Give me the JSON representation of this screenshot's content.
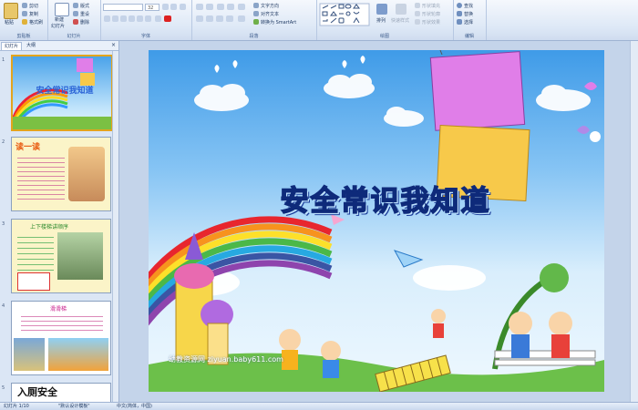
{
  "ribbon": {
    "clipboard": {
      "label": "剪贴板",
      "paste": "粘贴",
      "cut": "剪切",
      "copy": "复制",
      "format_painter": "格式刷"
    },
    "slides": {
      "label": "幻灯片",
      "new_slide": "新建",
      "new_slide2": "幻灯片",
      "layout": "版式",
      "reset": "重设",
      "delete": "删除"
    },
    "font": {
      "label": "字体",
      "font_name": "",
      "font_size": "32"
    },
    "paragraph": {
      "label": "段落",
      "text_direction": "文字方向",
      "align_text": "对齐文本",
      "smartart": "转换为 SmartArt"
    },
    "drawing": {
      "label": "绘图",
      "arrange": "排列",
      "quick_styles": "快速样式",
      "shape_fill": "形状填充",
      "shape_outline": "形状轮廓",
      "shape_effects": "形状效果"
    },
    "editing": {
      "label": "编辑",
      "find": "查找",
      "replace": "替换",
      "select": "选择"
    }
  },
  "panel": {
    "tab_slides": "幻灯片",
    "tab_outline": "大纲"
  },
  "thumbs": [
    {
      "num": "1",
      "title": "安全常识我知道"
    },
    {
      "num": "2",
      "title": "读一读"
    },
    {
      "num": "3",
      "title": "上下楼梯讲顺序"
    },
    {
      "num": "4",
      "title": "滑滑梯"
    },
    {
      "num": "5",
      "title": "入厕安全"
    }
  ],
  "slide": {
    "title": "安全常识我知道",
    "watermark": "幼教资源网 ziyuan.baby611.com"
  },
  "status": {
    "slide_count": "幻灯片 1/10",
    "theme": "\"默认设计模板\"",
    "language": "中文(简体，中国)"
  }
}
